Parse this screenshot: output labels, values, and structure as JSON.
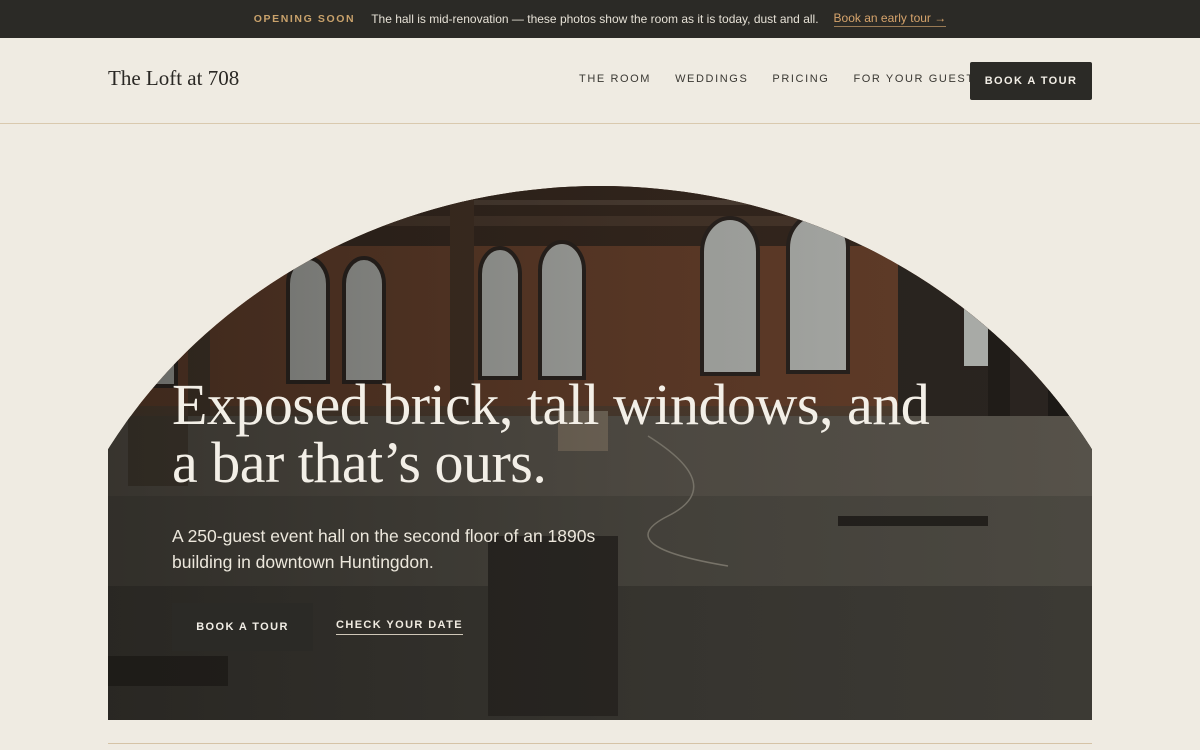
{
  "announcement": {
    "kicker": "OPENING SOON",
    "message": "The hall is mid-renovation — these photos show the room as it is today, dust and all.",
    "link_label": "Book an early tour →"
  },
  "header": {
    "brand": "The Loft at 708",
    "nav": [
      "THE ROOM",
      "WEDDINGS",
      "PRICING",
      "FOR YOUR GUESTS"
    ],
    "cta_label": "BOOK A TOUR"
  },
  "hero": {
    "headline": "Exposed brick, tall windows, and a bar that’s ours.",
    "subhead": "A 250-guest event hall on the second floor of an 1890s building in downtown Huntingdon.",
    "primary_cta": "BOOK A TOUR",
    "secondary_cta": "CHECK YOUR DATE"
  },
  "colors": {
    "background": "#efebe2",
    "dark": "#2b2a26",
    "accent": "#d6a46c"
  }
}
